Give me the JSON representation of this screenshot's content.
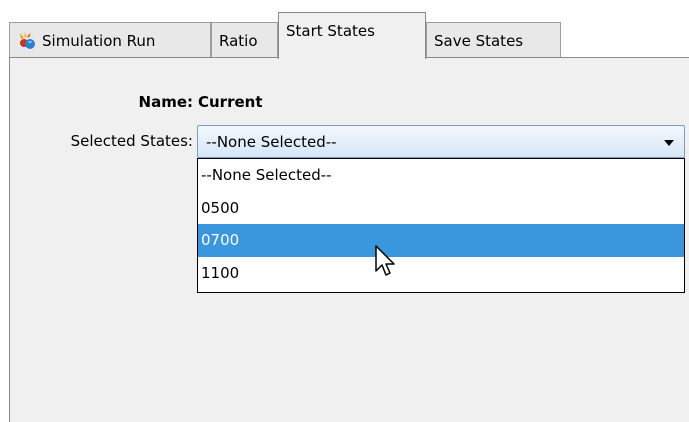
{
  "tabs": [
    {
      "label": "Simulation Run",
      "icon": "simulation-icon",
      "active": false
    },
    {
      "label": "Ratio",
      "active": false
    },
    {
      "label": "Start States",
      "active": true
    },
    {
      "label": "Save States",
      "active": false
    }
  ],
  "form": {
    "name_label": "Name:",
    "name_value": "Current",
    "states_label": "Selected States:",
    "states_selected": "--None Selected--"
  },
  "dropdown": {
    "options": [
      "--None Selected--",
      "0500",
      "0700",
      "1100"
    ],
    "highlighted": "0700"
  },
  "colors": {
    "highlight": "#3a96dd",
    "panel_bg": "#f0f0f0"
  }
}
